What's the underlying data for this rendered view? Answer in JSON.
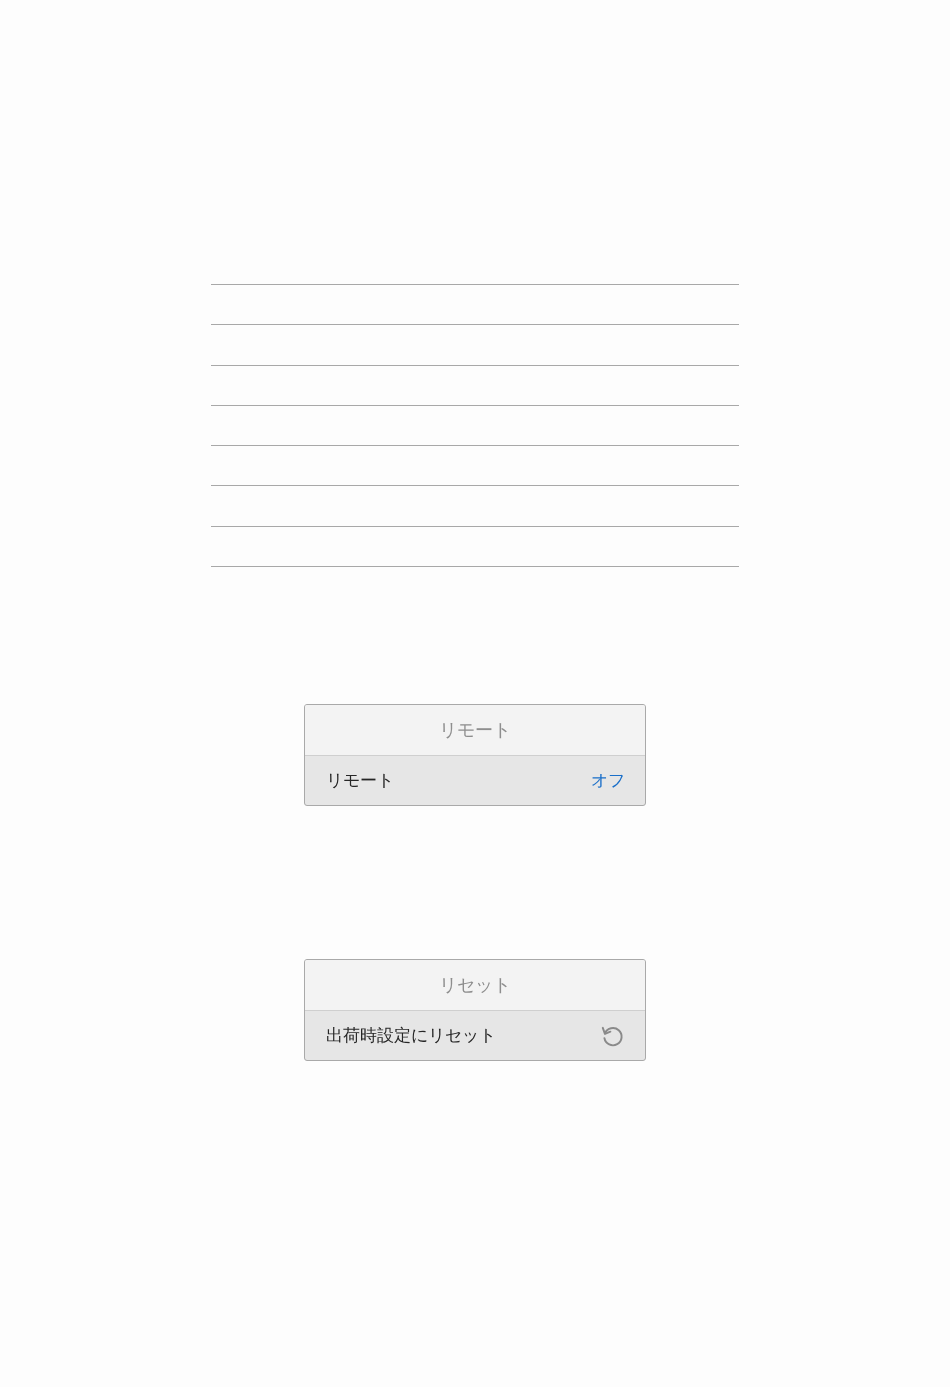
{
  "panels": [
    {
      "title": "リモート",
      "row": {
        "kind": "value",
        "label": "リモート",
        "value": "オフ"
      }
    },
    {
      "title": "リセット",
      "row": {
        "kind": "action",
        "label": "出荷時設定にリセット"
      }
    }
  ]
}
